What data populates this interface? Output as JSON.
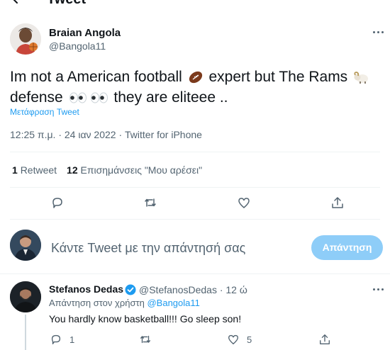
{
  "header": {
    "title": "Tweet"
  },
  "tweet": {
    "author_name": "Braian Angola",
    "author_handle": "@Bangola11",
    "text_parts": [
      "Im not a American football ",
      " expert but The Rams ",
      " defense ",
      " they are eliteee .."
    ],
    "emoji": [
      "american-football",
      "ram",
      "eyes",
      "eyes"
    ],
    "translate": "Μετάφραση Tweet",
    "meta": "12:25 π.μ. · 24 ιαν 2022 · Twitter for iPhone",
    "stats": {
      "retweets_count": "1",
      "retweets_label": "Retweet",
      "likes_count": "12",
      "likes_label": "Επισημάνσεις \"Μου αρέσει\""
    }
  },
  "compose": {
    "placeholder": "Κάντε Tweet με την απάντησή σας",
    "button_label": "Απάντηση"
  },
  "reply": {
    "name": "Stefanos Dedas",
    "handle_time": "@StefanosDedas · 12 ώ",
    "replying_prefix": "Απάντηση στον χρήστη ",
    "replying_mention": "@Bangola11",
    "text": "You hardly know basketball!!! Go sleep son!",
    "replies_count": "1",
    "likes_count": "5"
  },
  "colors": {
    "accent": "#1d9bf0",
    "reply_button": "#8ecdf8",
    "secondary_text": "#536471",
    "verified": "#1d9bf0"
  }
}
